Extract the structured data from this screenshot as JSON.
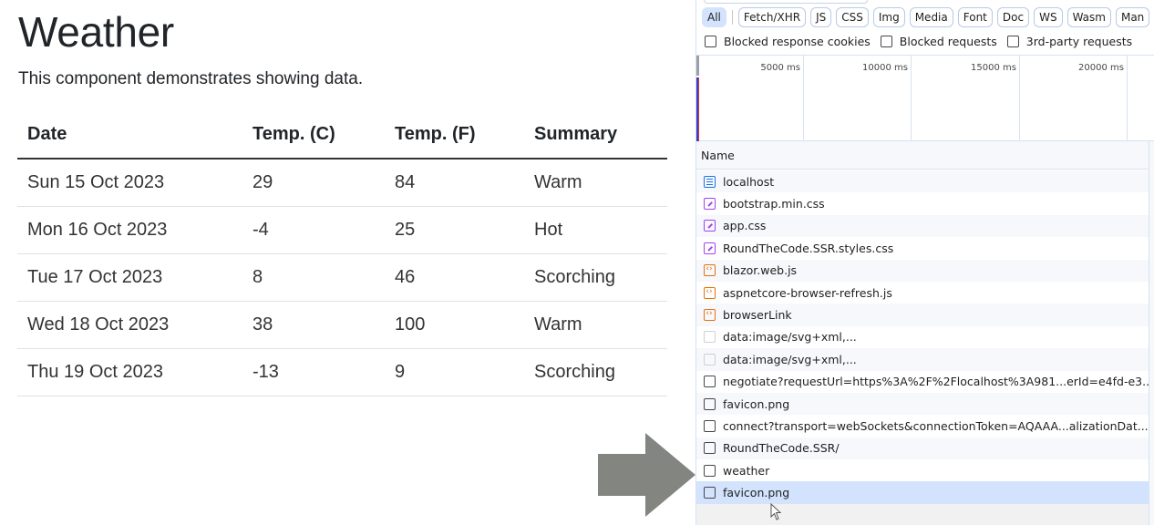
{
  "page": {
    "title": "Weather",
    "description": "This component demonstrates showing data.",
    "table": {
      "headers": [
        "Date",
        "Temp. (C)",
        "Temp. (F)",
        "Summary"
      ],
      "rows": [
        [
          "Sun 15 Oct 2023",
          "29",
          "84",
          "Warm"
        ],
        [
          "Mon 16 Oct 2023",
          "-4",
          "25",
          "Hot"
        ],
        [
          "Tue 17 Oct 2023",
          "8",
          "46",
          "Scorching"
        ],
        [
          "Wed 18 Oct 2023",
          "38",
          "100",
          "Warm"
        ],
        [
          "Thu 19 Oct 2023",
          "-13",
          "9",
          "Scorching"
        ]
      ]
    }
  },
  "annotation": {
    "arrow_color": "#838580",
    "arrow_icon": "arrow-right-icon"
  },
  "devtools": {
    "filters": [
      {
        "label": "All",
        "active": true
      },
      {
        "label": "Fetch/XHR"
      },
      {
        "label": "JS"
      },
      {
        "label": "CSS"
      },
      {
        "label": "Img"
      },
      {
        "label": "Media"
      },
      {
        "label": "Font"
      },
      {
        "label": "Doc"
      },
      {
        "label": "WS"
      },
      {
        "label": "Wasm"
      },
      {
        "label": "Man"
      }
    ],
    "checkboxes": [
      {
        "label": "Blocked response cookies",
        "checked": false
      },
      {
        "label": "Blocked requests",
        "checked": false
      },
      {
        "label": "3rd-party requests",
        "checked": false
      }
    ],
    "timeline_ticks": [
      "5000 ms",
      "10000 ms",
      "15000 ms",
      "20000 ms"
    ],
    "name_header": "Name",
    "requests": [
      {
        "name": "localhost",
        "type": "doc"
      },
      {
        "name": "bootstrap.min.css",
        "type": "css"
      },
      {
        "name": "app.css",
        "type": "css"
      },
      {
        "name": "RoundTheCode.SSR.styles.css",
        "type": "css"
      },
      {
        "name": "blazor.web.js",
        "type": "js"
      },
      {
        "name": "aspnetcore-browser-refresh.js",
        "type": "js"
      },
      {
        "name": "browserLink",
        "type": "js"
      },
      {
        "name": "data:image/svg+xml,...",
        "type": "img"
      },
      {
        "name": "data:image/svg+xml,...",
        "type": "img"
      },
      {
        "name": "negotiate?requestUrl=https%3A%2F%2Flocalhost%3A981...erId=e4fd-e3...",
        "type": "other"
      },
      {
        "name": "favicon.png",
        "type": "other"
      },
      {
        "name": "connect?transport=webSockets&connectionToken=AQAAA...alizationDat...",
        "type": "other"
      },
      {
        "name": "RoundTheCode.SSR/",
        "type": "other"
      },
      {
        "name": "weather",
        "type": "other"
      },
      {
        "name": "favicon.png",
        "type": "other",
        "selected": true
      }
    ]
  }
}
